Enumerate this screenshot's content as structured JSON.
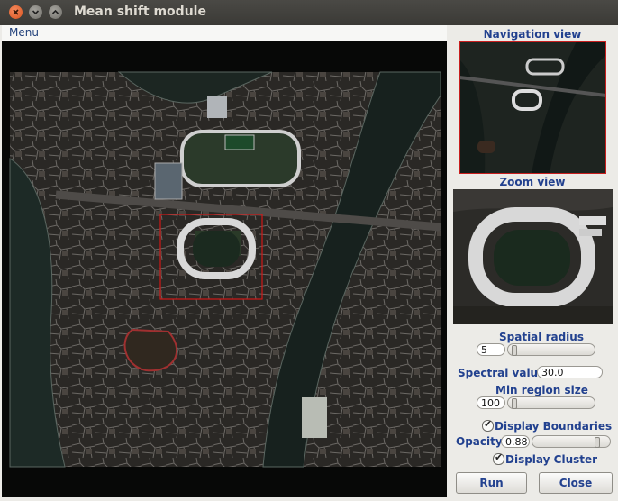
{
  "window": {
    "title": "Mean shift module"
  },
  "menubar": {
    "menu_label": "Menu"
  },
  "panels": {
    "navigation_label": "Navigation view",
    "zoom_label": "Zoom view"
  },
  "controls": {
    "spatial_radius": {
      "label": "Spatial radius",
      "value": "5",
      "slider_fraction": 0.05
    },
    "spectral_value": {
      "label": "Spectral value",
      "value": "30.0"
    },
    "min_region_size": {
      "label": "Min region size",
      "value": "100",
      "slider_fraction": 0.05
    },
    "display_boundaries": {
      "label": "Display Boundaries",
      "checked": true
    },
    "opacity": {
      "label": "Opacity",
      "value": "0.88",
      "slider_fraction": 0.88
    },
    "display_cluster": {
      "label": "Display Cluster",
      "checked": true
    }
  },
  "buttons": {
    "run_label": "Run",
    "close_label": "Close"
  },
  "colors": {
    "accent_label": "#22418f",
    "selection_box": "#d01818",
    "titlebar": "#3f3e3a"
  }
}
